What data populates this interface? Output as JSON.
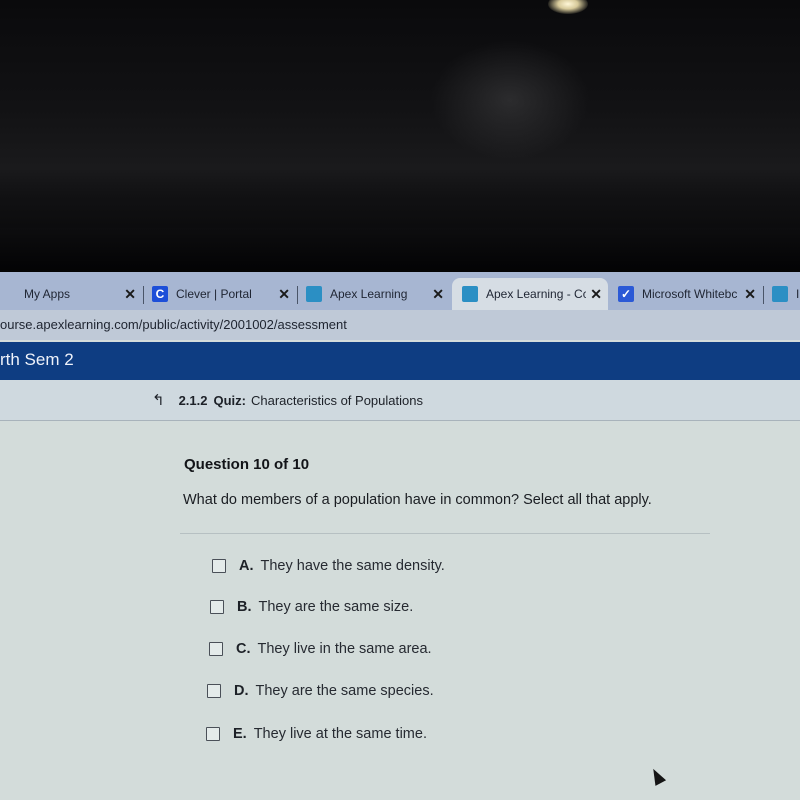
{
  "browser": {
    "tabs": [
      {
        "label": "My Apps",
        "icon": "apps-grid-icon",
        "active": false
      },
      {
        "label": "Clever | Portal",
        "icon": "clever-icon",
        "active": false
      },
      {
        "label": "Apex Learning",
        "icon": "apex-icon",
        "active": false
      },
      {
        "label": "Apex Learning - Cc",
        "icon": "apex-icon",
        "active": true
      },
      {
        "label": "Microsoft Whitebc",
        "icon": "microsoft-whiteboard-icon",
        "active": false
      },
      {
        "label": "I",
        "icon": "apex-icon",
        "active": false
      }
    ],
    "close_glyph": "✕",
    "url": "ourse.apexlearning.com/public/activity/2001002/assessment"
  },
  "course": {
    "title": "rth Sem 2"
  },
  "quiz": {
    "back_glyph": "↰",
    "number": "2.1.2",
    "type": "Quiz:",
    "title": "Characteristics of Populations"
  },
  "question": {
    "counter": "Question 10 of 10",
    "text": "What do members of a population have in common? Select all that apply.",
    "options": [
      {
        "letter": "A.",
        "text": "They have the same density.",
        "checked": false
      },
      {
        "letter": "B.",
        "text": "They are the same size.",
        "checked": false
      },
      {
        "letter": "C.",
        "text": "They live in the same area.",
        "checked": false
      },
      {
        "letter": "D.",
        "text": "They are the same species.",
        "checked": false
      },
      {
        "letter": "E.",
        "text": "They live at the same time.",
        "checked": false
      }
    ]
  },
  "colors": {
    "course_header": "#0e3d82",
    "tabstrip": "#a7b6d2"
  }
}
